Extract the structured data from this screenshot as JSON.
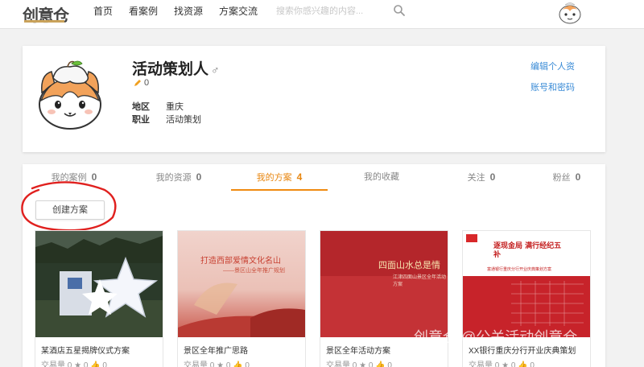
{
  "header": {
    "logo_text": "创意仓",
    "nav": [
      "首页",
      "看案例",
      "找资源",
      "方案交流"
    ],
    "search_placeholder": "搜索你感兴趣的内容..."
  },
  "profile": {
    "name": "活动策划人",
    "gender_symbol": "♂",
    "score": "0",
    "region_label": "地区",
    "region_value": "重庆",
    "job_label": "职业",
    "job_value": "活动策划",
    "edit_link": "编辑个人资",
    "account_link": "账号和密码"
  },
  "tabs": [
    {
      "label": "我的案例",
      "count": "0"
    },
    {
      "label": "我的资源",
      "count": "0"
    },
    {
      "label": "我的方案",
      "count": "4"
    },
    {
      "label": "我的收藏",
      "count": ""
    },
    {
      "label": "关注",
      "count": "0"
    },
    {
      "label": "粉丝",
      "count": "0"
    }
  ],
  "create_button": "创建方案",
  "cards": [
    {
      "title": "某酒店五星揭牌仪式方案",
      "meta": "交易量 0 ★ 0 👍 0"
    },
    {
      "title": "景区全年推广思路",
      "meta": "交易量 0 ★ 0 👍 0",
      "thumb_text": "打造西部爱情文化名山",
      "thumb_sub": "——景区山全年推广规划"
    },
    {
      "title": "景区全年活动方案",
      "meta": "交易量 0 ★ 0 👍 0",
      "thumb_text": "四面山水总是情",
      "thumb_sub": "江津四面山景区全年活动方案"
    },
    {
      "title": "XX银行重庆分行开业庆典策划",
      "meta": "交易量 0 ★ 0 👍 0",
      "thumb_text": "逐现金局 满行经纪五补",
      "thumb_sub": "富通银行重庆分行开业庆典策划方案"
    }
  ],
  "watermark": "创意仓 @公关活动创意仓",
  "colors": {
    "accent": "#f08a10",
    "link": "#3a8bd6",
    "circle": "#e0201e"
  }
}
